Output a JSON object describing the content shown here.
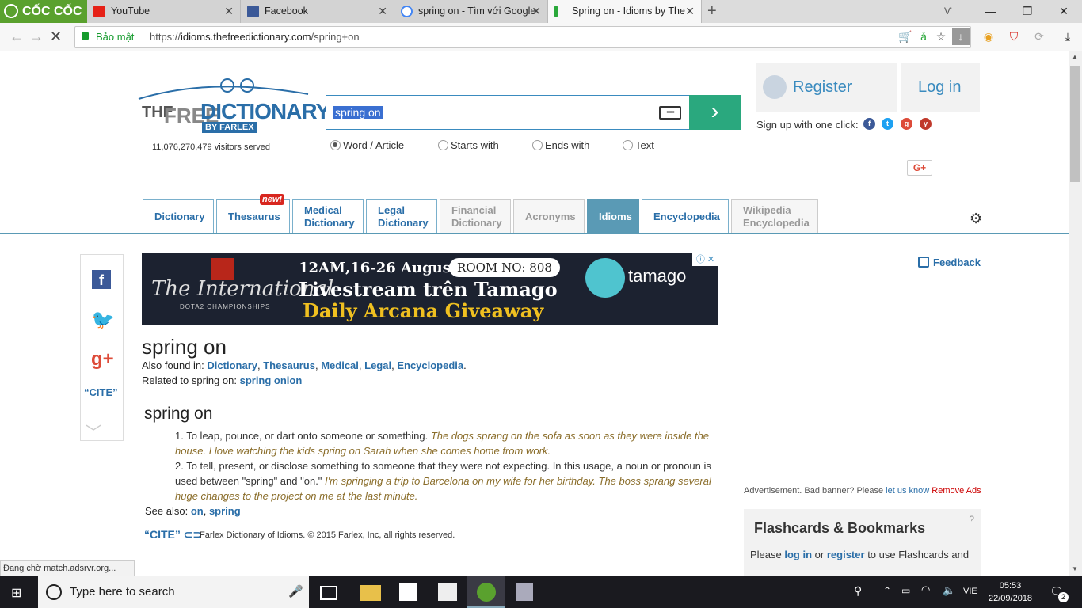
{
  "browser": {
    "brand": "CỐC CỐC",
    "tabs": [
      {
        "title": "YouTube",
        "color": "#e62117"
      },
      {
        "title": "Facebook",
        "color": "#3b5998"
      },
      {
        "title": "spring on - Tìm với Google",
        "color": "#4285f4"
      },
      {
        "title": "Spring on - Idioms by The",
        "color": "#2aa83a"
      }
    ],
    "security_label": "Bảo mật",
    "url_prefix": "https://",
    "url_host": "idioms.thefreedictionary.com",
    "url_path": "/spring+on",
    "status": "Đang chờ match.adsrvr.org..."
  },
  "site": {
    "logo_line1": "THE",
    "logo_line2": "FREE",
    "logo_line3": "DICTIONARY",
    "logo_by": "BY FARLEX",
    "visitors": "11,076,270,479 visitors served",
    "search_value": "spring on",
    "keyboard_icon": "keyboard-icon",
    "radios": [
      {
        "label": "Word / Article",
        "checked": true
      },
      {
        "label": "Starts with",
        "checked": false
      },
      {
        "label": "Ends with",
        "checked": false
      },
      {
        "label": "Text",
        "checked": false
      }
    ],
    "register": "Register",
    "login": "Log in",
    "signup": "Sign up with one click:",
    "gplus": "G+",
    "nav_tabs": [
      {
        "label": "Dictionary",
        "label2": ""
      },
      {
        "label": "Thesaurus",
        "label2": ""
      },
      {
        "label": "Medical",
        "label2": "Dictionary"
      },
      {
        "label": "Legal",
        "label2": "Dictionary"
      },
      {
        "label": "Financial",
        "label2": "Dictionary"
      },
      {
        "label": "Acronyms",
        "label2": ""
      },
      {
        "label": "Idioms",
        "label2": ""
      },
      {
        "label": "Encyclopedia",
        "label2": ""
      },
      {
        "label": "Wikipedia",
        "label2": "Encyclopedia"
      }
    ],
    "new_badge": "new!",
    "feedback": "Feedback",
    "cite": "“CITE”"
  },
  "ad": {
    "line1": "12AM,16-26 August",
    "room": "ROOM NO: 808",
    "line2": "Livestream trên Tamago",
    "line3": "Daily Arcana Giveaway",
    "intl": "The International",
    "dota": "DOTA2 CHAMPIONSHIPS",
    "tamago": "tamago"
  },
  "entry": {
    "headword": "spring on",
    "also_found_label": "Also found in:",
    "also_found": [
      "Dictionary",
      "Thesaurus",
      "Medical",
      "Legal",
      "Encyclopedia"
    ],
    "related_label": "Related to spring on:",
    "related_link": "spring onion",
    "subhead": "spring on",
    "def1_text": "1. To leap, pounce, or dart onto someone or something.",
    "def1_ex": "The dogs sprang on the sofa as soon as they were inside the house. I love watching the kids spring on Sarah when she comes home from work.",
    "def2_text": "2. To tell, present, or disclose something to someone that they were not expecting. In this usage, a noun or pronoun is used between \"spring\" and \"on.\"",
    "def2_ex": "I'm springing a trip to Barcelona on my wife for her birthday. The boss sprang several huge changes to the project on me at the last minute.",
    "see_also_label": "See also:",
    "see_also": [
      "on",
      "spring"
    ],
    "copyright": "Farlex Dictionary of Idioms. © 2015 Farlex, Inc, all rights reserved."
  },
  "sidebar": {
    "advert_text": "Advertisement. Bad banner? Please",
    "advert_link": "let us know",
    "advert_remove": "Remove Ads",
    "flash_title": "Flashcards & Bookmarks",
    "flash_q": "?",
    "flash_please": "Please",
    "flash_login": "log in",
    "flash_or": "or",
    "flash_register": "register",
    "flash_rest": "to use Flashcards and"
  },
  "taskbar": {
    "search_placeholder": "Type here to search",
    "lang": "VIE",
    "time": "05:53",
    "date": "22/09/2018",
    "notif_count": "2"
  }
}
